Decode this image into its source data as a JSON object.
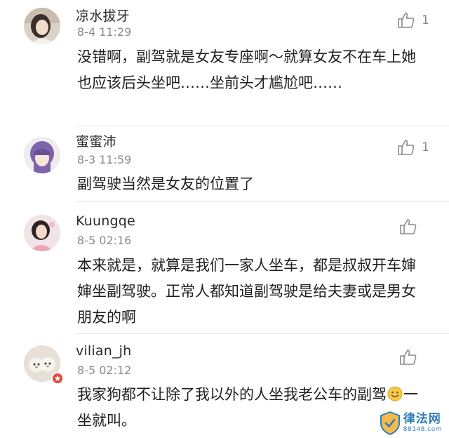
{
  "comments": [
    {
      "username": "凉水拔牙",
      "time": "8-4 11:29",
      "likes": "1",
      "text": "没错啊，副驾就是女友专座啊～就算女友不在车上她也应该后头坐吧……坐前头才尴尬吧……"
    },
    {
      "username": "蜜蜜沛",
      "time": "8-3 11:59",
      "likes": "1",
      "text": "副驾驶当然是女友的位置了"
    },
    {
      "username": "Kuungqe",
      "time": "8-5 02:16",
      "likes": "",
      "text": "本来就是，就算是我们一家人坐车，都是叔叔开车婶婶坐副驾驶。正常人都知道副驾驶是给夫妻或是男女朋友的啊"
    },
    {
      "username": "vilian_jh",
      "time": "8-5 02:12",
      "likes": "",
      "text_part1": "我家狗都不让除了我以外的人坐我老公车的副驾",
      "emoji": "smile-emoji",
      "text_part2": "一坐就叫。"
    }
  ],
  "icons": {
    "like": "thumbs-up-icon",
    "badge": "verified-badge-icon"
  },
  "watermark": {
    "title": "律法网",
    "subtitle": "88148.com"
  },
  "colors": {
    "text": "#1e1e1e",
    "meta": "#8a8a8a",
    "divider": "#e3e3e3",
    "badge": "#e0483e",
    "watermark": "#1f72b8"
  }
}
